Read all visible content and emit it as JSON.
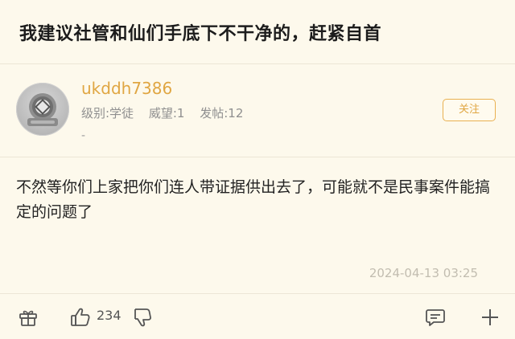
{
  "post": {
    "title": "我建议社管和仙们手底下不干净的，赶紧自首",
    "content": "不然等你们上家把你们连人带证据供出去了，可能就不是民事案件能搞定的问题了",
    "timestamp": "2024-04-13 03:25"
  },
  "author": {
    "username": "ukddh7386",
    "level": "级别:学徒",
    "prestige": "威望:1",
    "posts": "发帖:12",
    "signature": "-",
    "follow_label": "关注"
  },
  "actions": {
    "like_count": "234",
    "icons": [
      "gift-icon",
      "thumbs-up-icon",
      "thumbs-down-icon",
      "comment-icon",
      "plus-icon"
    ]
  },
  "colors": {
    "background": "#fdf9ec",
    "accent": "#e0a642",
    "divider": "#ece6d6"
  }
}
